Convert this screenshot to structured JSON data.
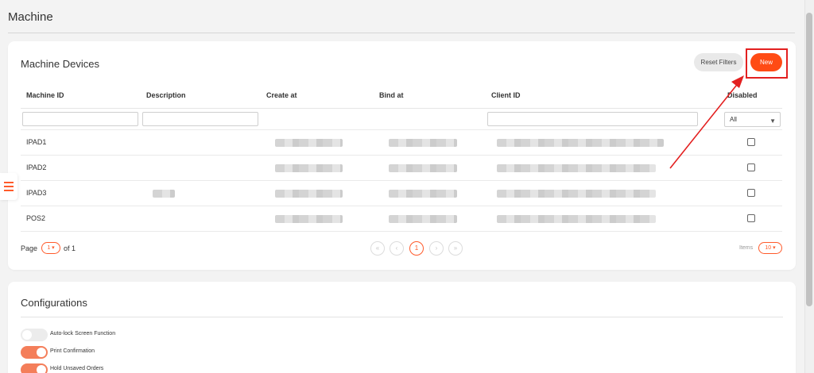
{
  "page": {
    "title": "Machine"
  },
  "devices": {
    "heading": "Machine Devices",
    "reset_label": "Reset Filters",
    "new_label": "New",
    "columns": [
      "Machine ID",
      "Description",
      "Create at",
      "Bind at",
      "Client ID",
      "Disabled"
    ],
    "disabled_filter": "All",
    "rows": [
      {
        "machine_id": "IPAD1"
      },
      {
        "machine_id": "IPAD2"
      },
      {
        "machine_id": "IPAD3"
      },
      {
        "machine_id": "POS2"
      }
    ]
  },
  "pagination": {
    "page_label": "Page",
    "page_value": "1",
    "of_label": "of 1",
    "current": "1",
    "prev_first_symbol": "«",
    "prev_symbol": "‹",
    "next_symbol": "›",
    "next_last_symbol": "»",
    "items_label": "Items",
    "items_value": "10"
  },
  "config": {
    "heading": "Configurations",
    "toggles": [
      {
        "label": "Auto-lock Screen Function",
        "on": false
      },
      {
        "label": "Print Confirmation",
        "on": true
      },
      {
        "label": "Hold Unsaved Orders",
        "on": true
      }
    ]
  },
  "icons": {
    "menu": "hamburger-icon",
    "dropdown": "caret-down-icon",
    "annotation": "red-arrow-icon"
  },
  "colors": {
    "accent": "#ff4b14",
    "annotation": "#e32020",
    "toggle_on": "#f47e5a"
  }
}
